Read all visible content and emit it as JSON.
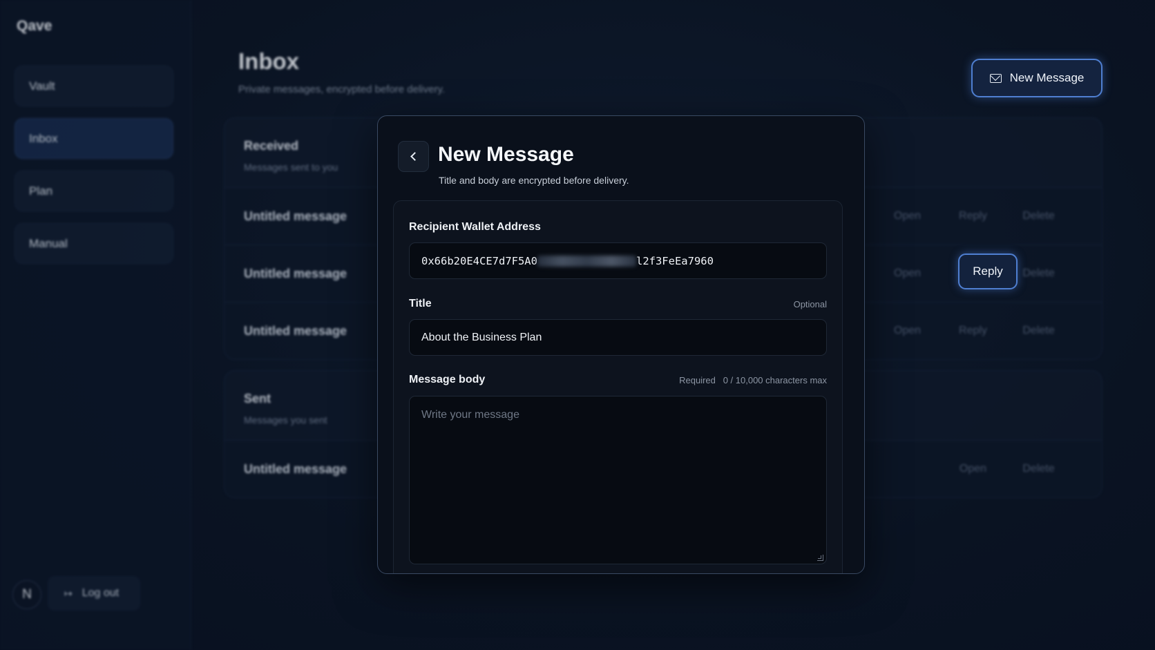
{
  "sidebar": {
    "brand": "Qave",
    "items": [
      {
        "label": "Vault"
      },
      {
        "label": "Inbox"
      },
      {
        "label": "Plan"
      },
      {
        "label": "Manual"
      }
    ],
    "avatar_initial": "N",
    "logout_label": "Log out"
  },
  "header": {
    "title": "Inbox",
    "subtitle": "Private messages, encrypted before delivery.",
    "new_message_label": "New Message"
  },
  "received": {
    "title": "Received",
    "subtitle": "Messages sent to you",
    "rows": [
      {
        "title": "Untitled message",
        "open": "Open",
        "reply": "Reply",
        "delete": "Delete"
      },
      {
        "title": "Untitled message",
        "open": "Open",
        "reply": "Reply",
        "delete": "Delete"
      },
      {
        "title": "Untitled message",
        "open": "Open",
        "reply": "Reply",
        "delete": "Delete"
      }
    ]
  },
  "sent": {
    "title": "Sent",
    "subtitle": "Messages you sent",
    "rows": [
      {
        "title": "Untitled message",
        "open": "Open",
        "delete": "Delete"
      }
    ]
  },
  "modal": {
    "title": "New Message",
    "subtitle": "Title and body are encrypted before delivery.",
    "recipient_label": "Recipient Wallet Address",
    "recipient_value_start": "0x66b20E4CE7d7F5A0",
    "recipient_value_end": "l2f3FeEa7960",
    "title_label": "Title",
    "title_hint": "Optional",
    "title_value": "About the Business Plan",
    "body_label": "Message body",
    "body_hint": "Required   0 / 10,000 characters max",
    "body_placeholder": "Write your message"
  },
  "colors": {
    "background": "#0b1424",
    "accent": "#4f7fd1",
    "modal_bg": "#0a101b"
  },
  "icons": [
    "mail-icon",
    "logout-icon",
    "chevron-left-icon",
    "resize-handle-icon"
  ]
}
